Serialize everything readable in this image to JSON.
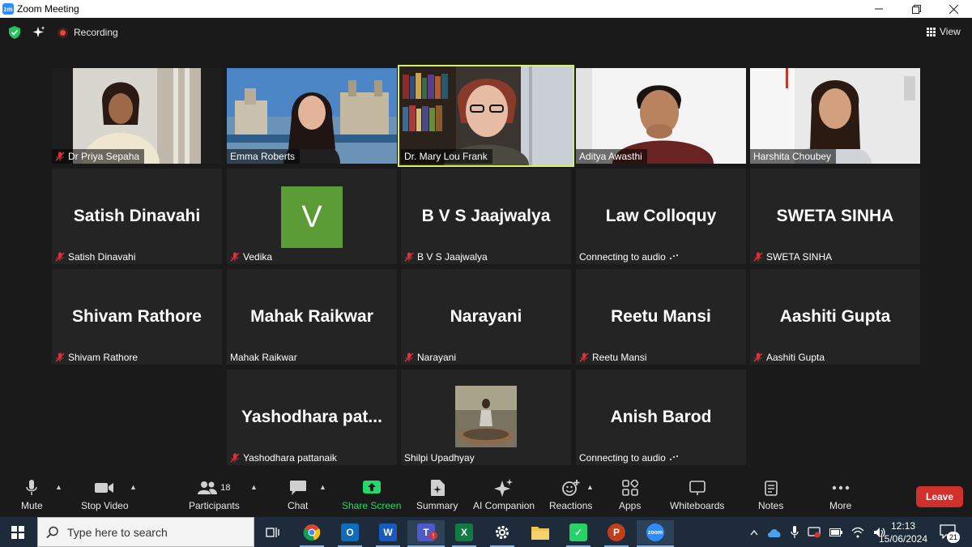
{
  "window": {
    "title": "Zoom Meeting",
    "controls": [
      "minimize",
      "restore",
      "close"
    ]
  },
  "topbar": {
    "recording_label": "Recording",
    "view_label": "View"
  },
  "tiles": [
    {
      "display_name": "Dr Priya Sepaha",
      "muted": true,
      "video": true
    },
    {
      "display_name": "Emma Roberts",
      "muted": false,
      "video": true
    },
    {
      "display_name": "Dr. Mary Lou Frank",
      "muted": false,
      "video": true,
      "active_speaker": true
    },
    {
      "display_name": "Aditya Awasthi",
      "muted": false,
      "video": true
    },
    {
      "display_name": "Harshita Choubey",
      "muted": false,
      "video": true
    },
    {
      "big_name": "Satish Dinavahi",
      "display_name": "Satish Dinavahi",
      "muted": true
    },
    {
      "avatar_letter": "V",
      "display_name": "Vedika",
      "muted": true
    },
    {
      "big_name": "B V S Jaajwalya",
      "display_name": "B V S Jaajwalya",
      "muted": true
    },
    {
      "big_name": "Law Colloquy",
      "display_name": "Connecting to audio",
      "muted": false
    },
    {
      "big_name": "SWETA SINHA",
      "display_name": "SWETA SINHA",
      "muted": true
    },
    {
      "big_name": "Shivam Rathore",
      "display_name": "Shivam Rathore",
      "muted": true
    },
    {
      "big_name": "Mahak Raikwar",
      "display_name": "Mahak Raikwar",
      "muted": false
    },
    {
      "big_name": "Narayani",
      "display_name": "Narayani",
      "muted": true
    },
    {
      "big_name": "Reetu Mansi",
      "display_name": "Reetu Mansi",
      "muted": true
    },
    {
      "big_name": "Aashiti Gupta",
      "display_name": "Aashiti Gupta",
      "muted": true
    },
    {
      "big_name": "Yashodhara  pat...",
      "display_name": "Yashodhara pattanaik",
      "muted": true
    },
    {
      "display_name": "Shilpi Upadhyay",
      "muted": false,
      "profile_photo": true
    },
    {
      "big_name": "Anish Barod",
      "display_name": "Connecting to audio",
      "muted": false
    }
  ],
  "toolbar": {
    "mute": "Mute",
    "stop_video": "Stop Video",
    "participants": "Participants",
    "participants_count": "18",
    "chat": "Chat",
    "share_screen": "Share Screen",
    "summary": "Summary",
    "ai_companion": "AI Companion",
    "reactions": "Reactions",
    "apps": "Apps",
    "whiteboards": "Whiteboards",
    "notes": "Notes",
    "more": "More",
    "leave": "Leave"
  },
  "taskbar": {
    "search_placeholder": "Type here to search",
    "apps": [
      "task-view",
      "chrome",
      "outlook",
      "word",
      "teams",
      "excel",
      "settings",
      "file-explorer",
      "whatsapp",
      "powerpoint",
      "zoom"
    ],
    "time": "12:13",
    "date": "15/06/2024",
    "notification_count": "21"
  },
  "colors": {
    "active_speaker_border": "#d6f06a",
    "leave_button": "#d0312d",
    "share_screen": "#23d96b",
    "recording_dot": "#e8453c",
    "vedika_avatar": "#5b9c36"
  }
}
